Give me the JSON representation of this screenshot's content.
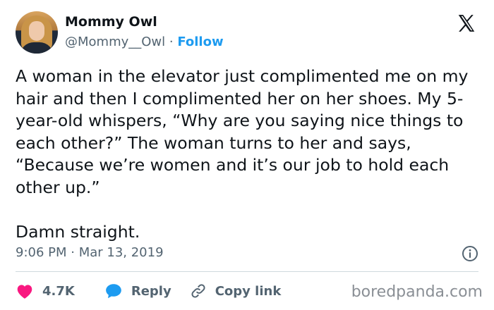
{
  "author": {
    "name": "Mommy Owl",
    "handle": "@Mommy__Owl",
    "separator": " · ",
    "follow_label": "Follow"
  },
  "tweet": {
    "text": "A woman in the elevator just complimented me on my hair and then I complimented her on her shoes. My 5-year-old whispers, “Why are you saying nice things to each other?” The woman turns to her and says, “Because we’re women and it’s our job to hold each other up.”\n\nDamn straight.",
    "timestamp": "9:06 PM · Mar 13, 2019"
  },
  "actions": {
    "like_count": "4.7K",
    "reply_label": "Reply",
    "copy_link_label": "Copy link"
  },
  "icons": {
    "logo": "x-logo-icon",
    "info": "info-icon",
    "like": "heart-icon",
    "reply": "speech-bubble-icon",
    "copy": "link-icon"
  },
  "colors": {
    "accent": "#1d9bf0",
    "like": "#f91880",
    "text": "#0f1419",
    "muted": "#536471"
  },
  "watermark": "boredpanda.com"
}
